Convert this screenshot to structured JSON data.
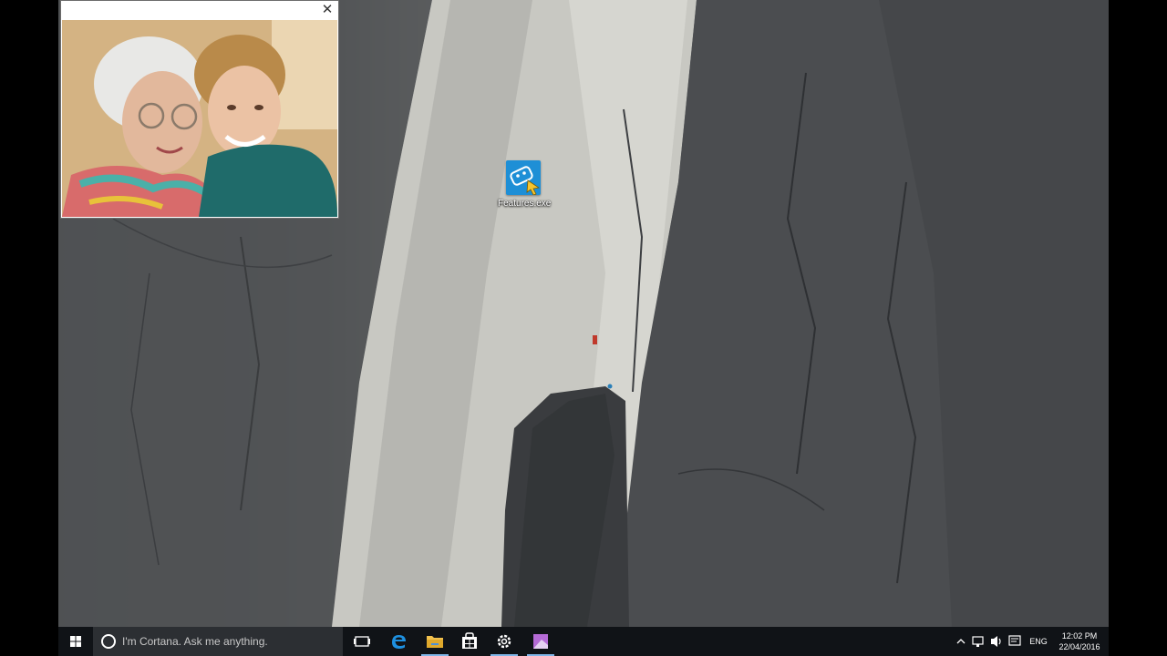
{
  "desktop": {
    "icons": [
      {
        "label": "Features.exe"
      }
    ]
  },
  "popup": {
    "close_glyph": "✕"
  },
  "taskbar": {
    "search_placeholder": "I'm Cortana. Ask me anything.",
    "pinned": [
      {
        "icon": "task-view-icon"
      },
      {
        "icon": "edge-icon",
        "color": "#1e90e0"
      },
      {
        "icon": "file-explorer-icon",
        "color": "#f2c14e"
      },
      {
        "icon": "store-icon"
      },
      {
        "icon": "settings-icon"
      },
      {
        "icon": "app-icon",
        "color": "#b56bd6"
      }
    ],
    "tray": {
      "language": "ENG",
      "time": "12:02 PM",
      "date": "22/04/2016"
    }
  }
}
